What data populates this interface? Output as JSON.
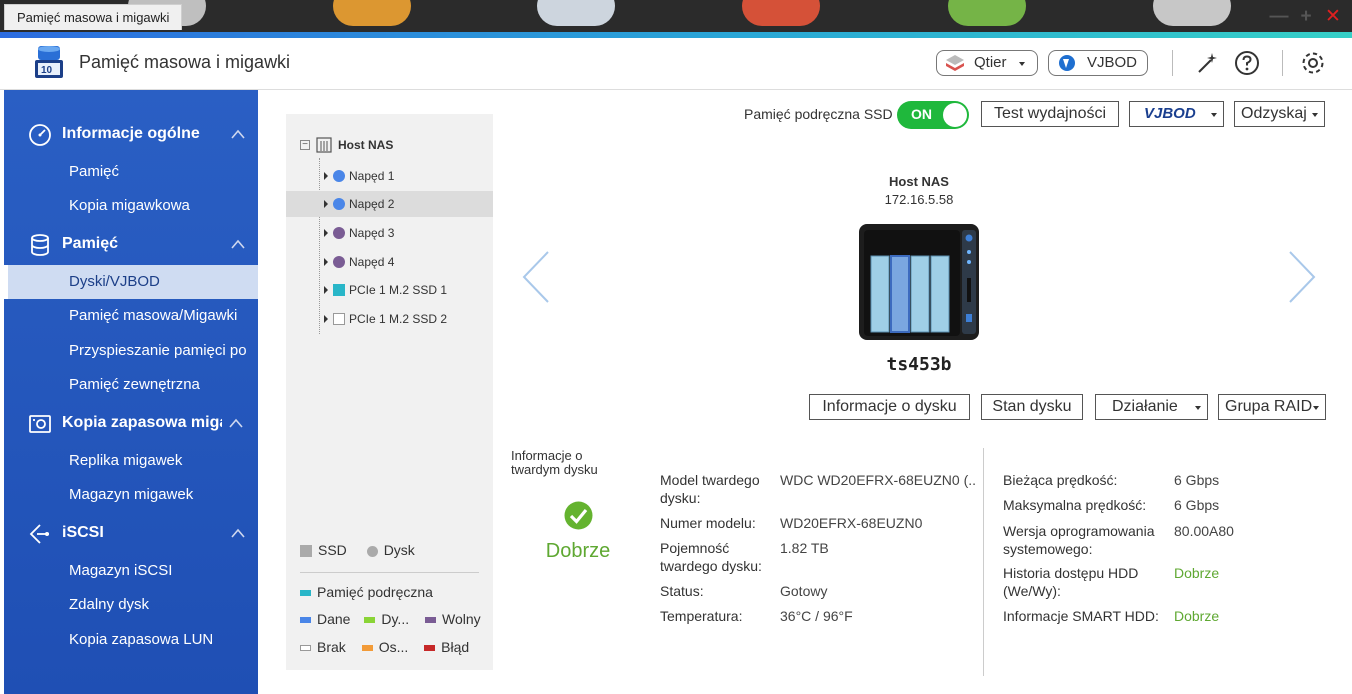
{
  "window": {
    "tab_title": "Pamięć masowa i migawki",
    "minimize": "—",
    "maximize": "+",
    "close": "✕"
  },
  "appbar": {
    "title": "Pamięć masowa i migawki",
    "qtier_label": "Qtier",
    "vjbod_label": "VJBOD",
    "icons": [
      "storage-app-icon",
      "qtier-icon",
      "vjbod-icon",
      "magic-wand-icon",
      "help-icon",
      "gear-icon"
    ]
  },
  "sidebar": {
    "sections": [
      {
        "label": "Informacje ogólne",
        "icon": "dashboard-icon",
        "items": [
          "Pamięć",
          "Kopia migawkowa"
        ]
      },
      {
        "label": "Pamięć",
        "icon": "database-icon",
        "items": [
          "Dyski/VJBOD",
          "Pamięć masowa/Migawki",
          "Przyspieszanie pamięci po",
          "Pamięć zewnętrzna"
        ]
      },
      {
        "label": "Kopia zapasowa miga",
        "icon": "snapshot-backup-icon",
        "items": [
          "Replika migawek",
          "Magazyn migawek"
        ]
      },
      {
        "label": "iSCSI",
        "icon": "iscsi-icon",
        "items": [
          "Magazyn iSCSI",
          "Zdalny dysk",
          "Kopia zapasowa LUN"
        ]
      }
    ],
    "active_item": "Dyski/VJBOD"
  },
  "tree": {
    "root": "Host NAS",
    "nodes": [
      {
        "label": "Napęd 1",
        "color": "#4a86e8",
        "shape": "dot"
      },
      {
        "label": "Napęd 2",
        "color": "#4a86e8",
        "shape": "dot",
        "selected": true
      },
      {
        "label": "Napęd 3",
        "color": "#7a5c94",
        "shape": "dot"
      },
      {
        "label": "Napęd 4",
        "color": "#7a5c94",
        "shape": "dot"
      },
      {
        "label": "PCIe 1 M.2 SSD 1",
        "color": "#29b6c8",
        "shape": "square"
      },
      {
        "label": "PCIe 1 M.2 SSD 2",
        "color": "#ffffff",
        "shape": "square"
      }
    ],
    "legend": {
      "type_ssd": "SSD",
      "type_disk": "Dysk",
      "cache": "Pamięć podręczna",
      "data": "Dane",
      "dy": "Dy...",
      "free": "Wolny",
      "none": "Brak",
      "os": "Os...",
      "error": "Błąd",
      "colors": {
        "ssd": "#aaaaaa",
        "disk": "#aaaaaa",
        "cache": "#29b6c8",
        "data": "#4a86e8",
        "dy": "#8ad436",
        "free": "#7a5c94",
        "none": "#ffffff",
        "os": "#f29b38",
        "error": "#c62828"
      }
    }
  },
  "toolbar": {
    "ssd_cache_label": "Pamięć podręczna SSD",
    "toggle_state": "ON",
    "perf_test": "Test wydajności",
    "vjbod_logo": "VJBOD",
    "recover": "Odzyskaj"
  },
  "device": {
    "name": "Host NAS",
    "ip": "172.16.5.58",
    "model": "ts453b"
  },
  "actions": {
    "disk_info": "Informacje o dysku",
    "disk_status": "Stan dysku",
    "action": "Działanie",
    "raid_group": "Grupa RAID"
  },
  "health": {
    "title": "Informacje o twardym dysku",
    "status": "Dobrze"
  },
  "info_left": [
    {
      "key": "Model twardego dysku:",
      "value": "WDC WD20EFRX-68EUZN0 (..."
    },
    {
      "key": "Numer modelu:",
      "value": "WD20EFRX-68EUZN0"
    },
    {
      "key": "Pojemność twardego dysku:",
      "value": "1.82 TB"
    },
    {
      "key": "Status:",
      "value": "Gotowy"
    },
    {
      "key": "Temperatura:",
      "value": "36°C / 96°F"
    }
  ],
  "info_right": [
    {
      "key": "Bieżąca prędkość:",
      "value": "6 Gbps"
    },
    {
      "key": "Maksymalna prędkość:",
      "value": "6 Gbps"
    },
    {
      "key": "Wersja oprogramowania systemowego:",
      "value": "80.00A80"
    },
    {
      "key": "Historia dostępu HDD (We/Wy):",
      "value": "Dobrze"
    },
    {
      "key": "Informacje SMART HDD:",
      "value": "Dobrze"
    }
  ]
}
